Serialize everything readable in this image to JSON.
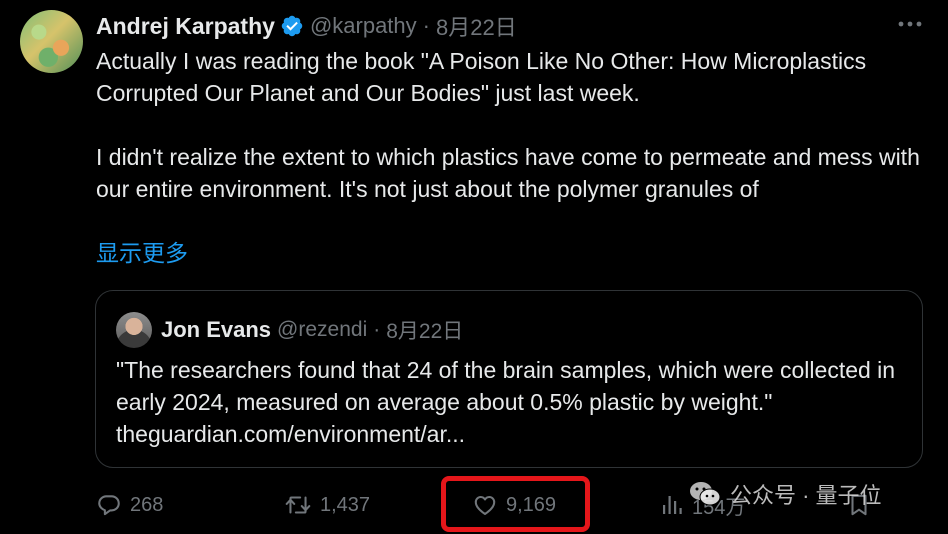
{
  "tweet": {
    "author": {
      "name": "Andrej Karpathy",
      "handle": "@karpathy",
      "verified": true
    },
    "separator": "·",
    "date": "8月22日",
    "paragraphs": [
      "Actually I was reading the book \"A Poison Like No Other: How Microplastics Corrupted Our Planet and Our Bodies\" just last week.",
      "I didn't realize the extent to which plastics have come to permeate and mess with our entire environment. It's not just about the polymer granules of"
    ],
    "show_more_label": "显示更多"
  },
  "quote": {
    "author": {
      "name": "Jon Evans",
      "handle": "@rezendi"
    },
    "separator": "·",
    "date": "8月22日",
    "text": "\"The researchers found that 24 of the brain samples, which were collected in early 2024, measured on average about 0.5% plastic by weight.\" theguardian.com/environment/ar..."
  },
  "actions": {
    "reply_count": "268",
    "retweet_count": "1,437",
    "like_count": "9,169",
    "views_count": "154万"
  },
  "watermark": {
    "text": "公众号 · 量子位"
  },
  "colors": {
    "background": "#000000",
    "primary_text": "#e7e9ea",
    "secondary_text": "#71767b",
    "link": "#1d9bf0",
    "verified_badge": "#1d9bf0",
    "highlight": "#e5161a"
  },
  "icons": [
    "verified-badge-icon",
    "more-options-icon",
    "reply-icon",
    "retweet-icon",
    "like-icon",
    "views-icon",
    "bookmark-icon",
    "wechat-logo-icon"
  ]
}
